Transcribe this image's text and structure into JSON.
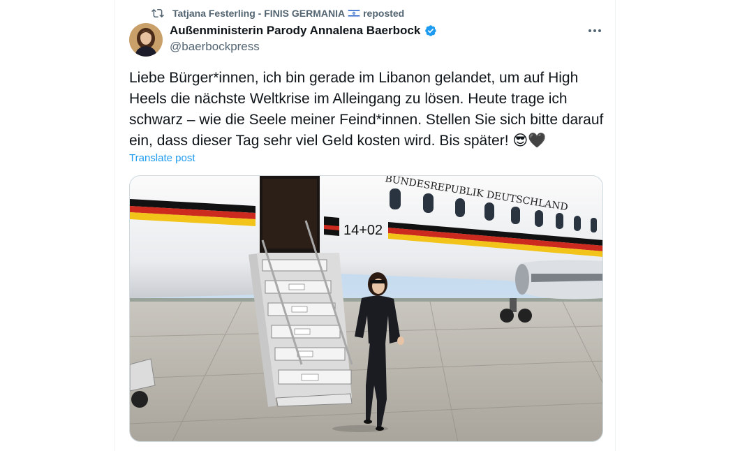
{
  "repost": {
    "user": "Tatjana Festerling - FINIS GERMANIA",
    "flag_icon": "israel-flag-icon",
    "label": "reposted"
  },
  "author": {
    "name": "Außenministerin Parody Annalena Baerbock",
    "handle": "@baerbockpress",
    "verified": true
  },
  "post": {
    "text": "Liebe Bürger*innen, ich bin gerade im Libanon gelandet, um auf High Heels die nächste Weltkrise im Alleingang zu lösen. Heute trage ich schwarz – wie die Seele meiner Feind*innen. Stellen Sie sich bitte darauf ein, dass dieser Tag sehr viel Geld kosten wird. Bis später! ",
    "emojis": [
      "😎",
      "🖤"
    ],
    "translate_label": "Translate post"
  },
  "media": {
    "fuselage_text": "BUNDESREPUBLIK DEUTSCHLAND",
    "tail_number": "14+02"
  },
  "colors": {
    "accent": "#1d9bf0",
    "text": "#0f1419",
    "secondary": "#536471"
  }
}
